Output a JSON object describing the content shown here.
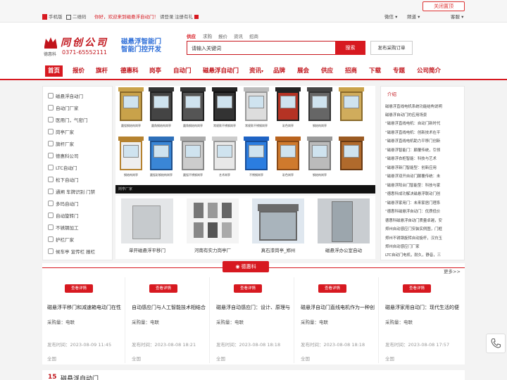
{
  "topbar": {
    "close_ad": "关闭置顶",
    "mobile": "手机版",
    "qrcode": "二维码",
    "welcome": "你好，欢迎来到磁悬浮自动门！",
    "login": "请登录",
    "register": "注册有礼",
    "right_links": [
      "微信",
      "频道",
      "客服"
    ],
    "colors": {
      "accent": "#d71920"
    }
  },
  "header": {
    "logo_name": "同创公司",
    "logo_sub": "德惠科",
    "logo_tel": "0371-65552111",
    "slogan_line1": "磁悬浮智能门",
    "slogan_line2": "智能门控开发",
    "search_tabs": [
      "供应",
      "求购",
      "报价",
      "资讯",
      "招商"
    ],
    "search_placeholder": "请输入关键词",
    "search_button": "搜索",
    "post_button": "发布采购订单"
  },
  "nav": [
    "首页",
    "报价",
    "旗杆",
    "德惠科",
    "岗亭",
    "自动门",
    "磁悬浮自动门",
    "资讯",
    "品牌",
    "展会",
    "供应",
    "招商",
    "下载",
    "专题",
    "公司简介"
  ],
  "sidebar": [
    "磁悬浮自动门",
    "自动门厂家",
    "医用门，气密门",
    "岗亭厂家",
    "旗杆厂家",
    "德惠科公司",
    "LTC自动门",
    "松下自动门",
    "通闸 车牌识别 门禁",
    "多玛自动门",
    "自动旋转门",
    "不锈钢加工",
    "护栏厂家",
    "候车亭 宣传栏 报栏"
  ],
  "gallery": {
    "strip_text": "岗亭厂家",
    "row1": [
      "圆弧钢结构岗亭",
      "圆角钢结构岗亭",
      "圆角钢结构岗亭",
      "常规款不锈钢岗亭",
      "常规款不锈钢岗亭",
      "彩色岗亭",
      "钢结构岗亭"
    ],
    "row2": [
      "钢结构岗亭",
      "圆弧彩钢结构岗亭",
      "圆弧不锈钢岗亭",
      "艺术岗亭",
      "不锈钢岗亭",
      "彩色岗亭",
      "钢结构岗亭"
    ]
  },
  "cards": [
    "单开磁悬浮平移门",
    "河南有实力岗亭厂",
    "真石漆岗亭_郑州",
    "磁悬浮办公室自动"
  ],
  "news": {
    "title": "介绍",
    "items": [
      "磁悬浮直线电机系统功能结构说明",
      "磁悬浮自动门的应用场景",
      "“磁悬浮直线电机：自动门新时代",
      "“磁悬浮直线电机：创新技术在平",
      "“磁悬浮直线电机助力平移门创新",
      "“磁悬浮智能门：颠覆传统，引领",
      "“磁悬浮衣柜智能：科技与艺术",
      "“磁悬浮新门智能型：创新应用",
      "“磁悬浮双开自动门颠覆传统：未",
      "“磁悬浮阳台门智能型：科技与家",
      "“德惠科成功解决磁悬浮联动门创",
      "“磁悬浮家用门：未来家居门理系",
      "“德惠科磁悬浮自动门：优质低价",
      "德惠科磁悬浮自动门质量卓越，安",
      "郑州自动感应门安装实例图，门框",
      "郑州不锈钢旋转自动旋杆，汉白玉",
      "郑州自动感应门厂家",
      "LTC自动门电机，耐久，静音，三"
    ]
  },
  "section": {
    "title": "德惠科",
    "more": "更多>>",
    "items": [
      {
        "btn": "查看详情",
        "title": "磁悬浮平移门和减速箱电动门在性",
        "qty": "采购量：电联",
        "date": "发布时间：2023-08-09 11:45",
        "region": "全国"
      },
      {
        "btn": "查看详情",
        "title": "自动感应门与人工智能技术相结合",
        "qty": "采购量：电联",
        "date": "发布时间：2023-08-08 18:21",
        "region": "全国"
      },
      {
        "btn": "查看详情",
        "title": "磁悬浮自动感应门：设计、原理与",
        "qty": "采购量：电联",
        "date": "发布时间：2023-08-08 18:18",
        "region": "全国"
      },
      {
        "btn": "查看详情",
        "title": "磁悬浮自动门直线电机作为一种创",
        "qty": "采购量：电联",
        "date": "发布时间：2023-08-08 18:18",
        "region": "全国"
      },
      {
        "btn": "查看详情",
        "title": "磁悬浮家用自动门：现代生活的便",
        "qty": "采购量：电联",
        "date": "发布时间：2023-08-08 17:57",
        "region": "全国"
      }
    ]
  },
  "bottom": {
    "num": "15",
    "title": "磁悬浮自动门"
  }
}
